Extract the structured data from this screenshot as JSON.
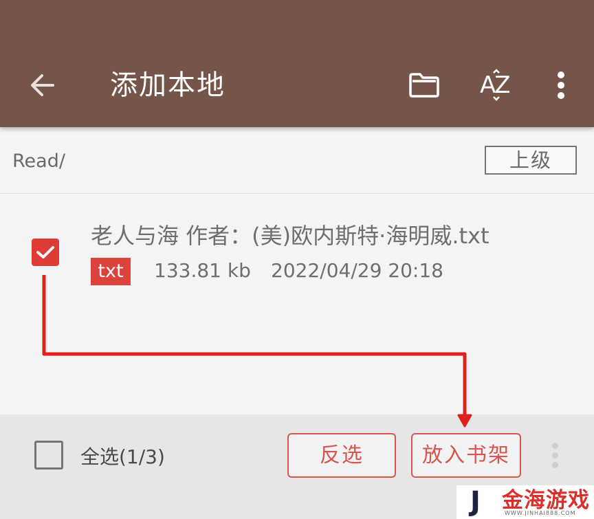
{
  "appbar": {
    "title": "添加本地",
    "back_icon": "arrow-left-icon",
    "folder_icon": "folder-icon",
    "sort_label": "AZ",
    "sort_icon": "sort-az-icon",
    "more_icon": "more-vert-icon",
    "color": "#75544a"
  },
  "path": {
    "current": "Read/",
    "up_label": "上级"
  },
  "files": [
    {
      "name": "老人与海 作者：(美)欧内斯特·海明威.txt",
      "type": "txt",
      "size": "133.81 kb",
      "date": "2022/04/29 20:18",
      "checked": true
    }
  ],
  "bottom": {
    "select_all_label": "全选(1/3)",
    "invert_label": "反选",
    "add_to_shelf_label": "放入书架",
    "more_icon": "more-vert-icon",
    "accent": "#d8554f"
  },
  "watermark": {
    "logo_letter": "J",
    "text": "金海游戏",
    "subtext": "WWW.JINHAI888.COM"
  },
  "annotation": {
    "color": "#e0201c"
  }
}
